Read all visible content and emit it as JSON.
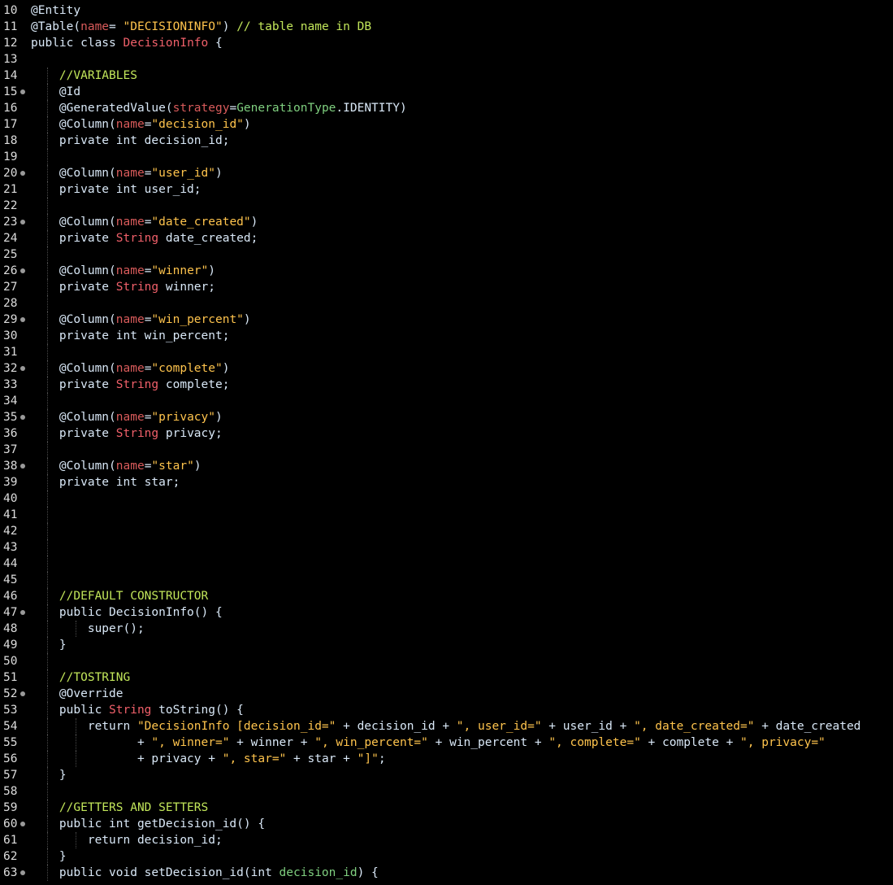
{
  "editor": {
    "language": "java",
    "colors": {
      "background": "#000000",
      "line_number": "#dcdcdc",
      "default_text": "#d9e8f7",
      "type_name": "#f0606a",
      "string_literal": "#ffc44d",
      "comment": "#c2e65a",
      "annotation_attribute": "#d95b5b",
      "enum_class": "#7fcf7f",
      "fold_marker": "#9a9a9a"
    },
    "lines": [
      {
        "number": "10",
        "fold": false,
        "indent": 0,
        "tokens": [
          {
            "text": "@Entity",
            "kind": "default"
          }
        ]
      },
      {
        "number": "11",
        "fold": false,
        "indent": 0,
        "tokens": [
          {
            "text": "@Table(",
            "kind": "default"
          },
          {
            "text": "name",
            "kind": "attr"
          },
          {
            "text": "= ",
            "kind": "default"
          },
          {
            "text": "\"DECISIONINFO\"",
            "kind": "string"
          },
          {
            "text": ") ",
            "kind": "default"
          },
          {
            "text": "// table name in DB",
            "kind": "comment"
          }
        ]
      },
      {
        "number": "12",
        "fold": false,
        "indent": 0,
        "tokens": [
          {
            "text": "public class ",
            "kind": "keyword"
          },
          {
            "text": "DecisionInfo",
            "kind": "type"
          },
          {
            "text": " {",
            "kind": "default"
          }
        ]
      },
      {
        "number": "13",
        "fold": false,
        "indent": 0,
        "tokens": []
      },
      {
        "number": "14",
        "fold": false,
        "indent": 1,
        "tokens": [
          {
            "text": "//VARIABLES",
            "kind": "comment"
          }
        ]
      },
      {
        "number": "15",
        "fold": true,
        "indent": 1,
        "tokens": [
          {
            "text": "@Id",
            "kind": "default"
          }
        ]
      },
      {
        "number": "16",
        "fold": false,
        "indent": 1,
        "tokens": [
          {
            "text": "@GeneratedValue(",
            "kind": "default"
          },
          {
            "text": "strategy",
            "kind": "attr"
          },
          {
            "text": "=",
            "kind": "default"
          },
          {
            "text": "GenerationType",
            "kind": "enum"
          },
          {
            "text": ".IDENTITY)",
            "kind": "default"
          }
        ]
      },
      {
        "number": "17",
        "fold": false,
        "indent": 1,
        "tokens": [
          {
            "text": "@Column(",
            "kind": "default"
          },
          {
            "text": "name",
            "kind": "attr"
          },
          {
            "text": "=",
            "kind": "default"
          },
          {
            "text": "\"decision_id\"",
            "kind": "string"
          },
          {
            "text": ")",
            "kind": "default"
          }
        ]
      },
      {
        "number": "18",
        "fold": false,
        "indent": 1,
        "tokens": [
          {
            "text": "private int decision_id;",
            "kind": "keyword"
          }
        ]
      },
      {
        "number": "19",
        "fold": false,
        "indent": 1,
        "tokens": []
      },
      {
        "number": "20",
        "fold": true,
        "indent": 1,
        "tokens": [
          {
            "text": "@Column(",
            "kind": "default"
          },
          {
            "text": "name",
            "kind": "attr"
          },
          {
            "text": "=",
            "kind": "default"
          },
          {
            "text": "\"user_id\"",
            "kind": "string"
          },
          {
            "text": ")",
            "kind": "default"
          }
        ]
      },
      {
        "number": "21",
        "fold": false,
        "indent": 1,
        "tokens": [
          {
            "text": "private int user_id;",
            "kind": "keyword"
          }
        ]
      },
      {
        "number": "22",
        "fold": false,
        "indent": 1,
        "tokens": []
      },
      {
        "number": "23",
        "fold": true,
        "indent": 1,
        "tokens": [
          {
            "text": "@Column(",
            "kind": "default"
          },
          {
            "text": "name",
            "kind": "attr"
          },
          {
            "text": "=",
            "kind": "default"
          },
          {
            "text": "\"date_created\"",
            "kind": "string"
          },
          {
            "text": ")",
            "kind": "default"
          }
        ]
      },
      {
        "number": "24",
        "fold": false,
        "indent": 1,
        "tokens": [
          {
            "text": "private ",
            "kind": "keyword"
          },
          {
            "text": "String",
            "kind": "type"
          },
          {
            "text": " date_created;",
            "kind": "default"
          }
        ]
      },
      {
        "number": "25",
        "fold": false,
        "indent": 1,
        "tokens": []
      },
      {
        "number": "26",
        "fold": true,
        "indent": 1,
        "tokens": [
          {
            "text": "@Column(",
            "kind": "default"
          },
          {
            "text": "name",
            "kind": "attr"
          },
          {
            "text": "=",
            "kind": "default"
          },
          {
            "text": "\"winner\"",
            "kind": "string"
          },
          {
            "text": ")",
            "kind": "default"
          }
        ]
      },
      {
        "number": "27",
        "fold": false,
        "indent": 1,
        "tokens": [
          {
            "text": "private ",
            "kind": "keyword"
          },
          {
            "text": "String",
            "kind": "type"
          },
          {
            "text": " winner;",
            "kind": "default"
          }
        ]
      },
      {
        "number": "28",
        "fold": false,
        "indent": 1,
        "tokens": []
      },
      {
        "number": "29",
        "fold": true,
        "indent": 1,
        "tokens": [
          {
            "text": "@Column(",
            "kind": "default"
          },
          {
            "text": "name",
            "kind": "attr"
          },
          {
            "text": "=",
            "kind": "default"
          },
          {
            "text": "\"win_percent\"",
            "kind": "string"
          },
          {
            "text": ")",
            "kind": "default"
          }
        ]
      },
      {
        "number": "30",
        "fold": false,
        "indent": 1,
        "tokens": [
          {
            "text": "private int win_percent;",
            "kind": "keyword"
          }
        ]
      },
      {
        "number": "31",
        "fold": false,
        "indent": 1,
        "tokens": []
      },
      {
        "number": "32",
        "fold": true,
        "indent": 1,
        "tokens": [
          {
            "text": "@Column(",
            "kind": "default"
          },
          {
            "text": "name",
            "kind": "attr"
          },
          {
            "text": "=",
            "kind": "default"
          },
          {
            "text": "\"complete\"",
            "kind": "string"
          },
          {
            "text": ")",
            "kind": "default"
          }
        ]
      },
      {
        "number": "33",
        "fold": false,
        "indent": 1,
        "tokens": [
          {
            "text": "private ",
            "kind": "keyword"
          },
          {
            "text": "String",
            "kind": "type"
          },
          {
            "text": " complete;",
            "kind": "default"
          }
        ]
      },
      {
        "number": "34",
        "fold": false,
        "indent": 1,
        "tokens": []
      },
      {
        "number": "35",
        "fold": true,
        "indent": 1,
        "tokens": [
          {
            "text": "@Column(",
            "kind": "default"
          },
          {
            "text": "name",
            "kind": "attr"
          },
          {
            "text": "=",
            "kind": "default"
          },
          {
            "text": "\"privacy\"",
            "kind": "string"
          },
          {
            "text": ")",
            "kind": "default"
          }
        ]
      },
      {
        "number": "36",
        "fold": false,
        "indent": 1,
        "tokens": [
          {
            "text": "private ",
            "kind": "keyword"
          },
          {
            "text": "String",
            "kind": "type"
          },
          {
            "text": " privacy;",
            "kind": "default"
          }
        ]
      },
      {
        "number": "37",
        "fold": false,
        "indent": 1,
        "tokens": []
      },
      {
        "number": "38",
        "fold": true,
        "indent": 1,
        "tokens": [
          {
            "text": "@Column(",
            "kind": "default"
          },
          {
            "text": "name",
            "kind": "attr"
          },
          {
            "text": "=",
            "kind": "default"
          },
          {
            "text": "\"star\"",
            "kind": "string"
          },
          {
            "text": ")",
            "kind": "default"
          }
        ]
      },
      {
        "number": "39",
        "fold": false,
        "indent": 1,
        "tokens": [
          {
            "text": "private int star;",
            "kind": "keyword"
          }
        ]
      },
      {
        "number": "40",
        "fold": false,
        "indent": 1,
        "tokens": []
      },
      {
        "number": "41",
        "fold": false,
        "indent": 1,
        "tokens": []
      },
      {
        "number": "42",
        "fold": false,
        "indent": 1,
        "tokens": []
      },
      {
        "number": "43",
        "fold": false,
        "indent": 1,
        "tokens": []
      },
      {
        "number": "44",
        "fold": false,
        "indent": 1,
        "tokens": []
      },
      {
        "number": "45",
        "fold": false,
        "indent": 1,
        "tokens": []
      },
      {
        "number": "46",
        "fold": false,
        "indent": 1,
        "tokens": [
          {
            "text": "//DEFAULT CONSTRUCTOR",
            "kind": "comment"
          }
        ]
      },
      {
        "number": "47",
        "fold": true,
        "indent": 1,
        "tokens": [
          {
            "text": "public DecisionInfo() {",
            "kind": "keyword"
          }
        ]
      },
      {
        "number": "48",
        "fold": false,
        "indent": 2,
        "tokens": [
          {
            "text": "super();",
            "kind": "keyword"
          }
        ]
      },
      {
        "number": "49",
        "fold": false,
        "indent": 1,
        "tokens": [
          {
            "text": "}",
            "kind": "default"
          }
        ]
      },
      {
        "number": "50",
        "fold": false,
        "indent": 1,
        "tokens": []
      },
      {
        "number": "51",
        "fold": false,
        "indent": 1,
        "tokens": [
          {
            "text": "//TOSTRING",
            "kind": "comment"
          }
        ]
      },
      {
        "number": "52",
        "fold": true,
        "indent": 1,
        "tokens": [
          {
            "text": "@Override",
            "kind": "default"
          }
        ]
      },
      {
        "number": "53",
        "fold": false,
        "indent": 1,
        "tokens": [
          {
            "text": "public ",
            "kind": "keyword"
          },
          {
            "text": "String",
            "kind": "type"
          },
          {
            "text": " toString() {",
            "kind": "default"
          }
        ]
      },
      {
        "number": "54",
        "fold": false,
        "indent": 2,
        "tokens": [
          {
            "text": "return ",
            "kind": "keyword"
          },
          {
            "text": "\"DecisionInfo [decision_id=\"",
            "kind": "string"
          },
          {
            "text": " + decision_id + ",
            "kind": "default"
          },
          {
            "text": "\", user_id=\"",
            "kind": "string"
          },
          {
            "text": " + user_id + ",
            "kind": "default"
          },
          {
            "text": "\", date_created=\"",
            "kind": "string"
          },
          {
            "text": " + date_created",
            "kind": "default"
          }
        ]
      },
      {
        "number": "55",
        "fold": false,
        "indent": 2,
        "extra_indent": "       ",
        "tokens": [
          {
            "text": "+ ",
            "kind": "default"
          },
          {
            "text": "\", winner=\"",
            "kind": "string"
          },
          {
            "text": " + winner + ",
            "kind": "default"
          },
          {
            "text": "\", win_percent=\"",
            "kind": "string"
          },
          {
            "text": " + win_percent + ",
            "kind": "default"
          },
          {
            "text": "\", complete=\"",
            "kind": "string"
          },
          {
            "text": " + complete + ",
            "kind": "default"
          },
          {
            "text": "\", privacy=\"",
            "kind": "string"
          }
        ]
      },
      {
        "number": "56",
        "fold": false,
        "indent": 2,
        "extra_indent": "       ",
        "tokens": [
          {
            "text": "+ privacy + ",
            "kind": "default"
          },
          {
            "text": "\", star=\"",
            "kind": "string"
          },
          {
            "text": " + star + ",
            "kind": "default"
          },
          {
            "text": "\"]\"",
            "kind": "string"
          },
          {
            "text": ";",
            "kind": "default"
          }
        ]
      },
      {
        "number": "57",
        "fold": false,
        "indent": 1,
        "tokens": [
          {
            "text": "}",
            "kind": "default"
          }
        ]
      },
      {
        "number": "58",
        "fold": false,
        "indent": 1,
        "tokens": []
      },
      {
        "number": "59",
        "fold": false,
        "indent": 1,
        "tokens": [
          {
            "text": "//GETTERS AND SETTERS",
            "kind": "comment"
          }
        ]
      },
      {
        "number": "60",
        "fold": true,
        "indent": 1,
        "tokens": [
          {
            "text": "public int getDecision_id() {",
            "kind": "keyword"
          }
        ]
      },
      {
        "number": "61",
        "fold": false,
        "indent": 2,
        "tokens": [
          {
            "text": "return decision_id;",
            "kind": "keyword"
          }
        ]
      },
      {
        "number": "62",
        "fold": false,
        "indent": 1,
        "tokens": [
          {
            "text": "}",
            "kind": "default"
          }
        ]
      },
      {
        "number": "63",
        "fold": true,
        "indent": 1,
        "tokens": [
          {
            "text": "public void setDecision_id(int ",
            "kind": "keyword"
          },
          {
            "text": "decision_id",
            "kind": "enum_param"
          },
          {
            "text": ") {",
            "kind": "default"
          }
        ]
      }
    ]
  }
}
